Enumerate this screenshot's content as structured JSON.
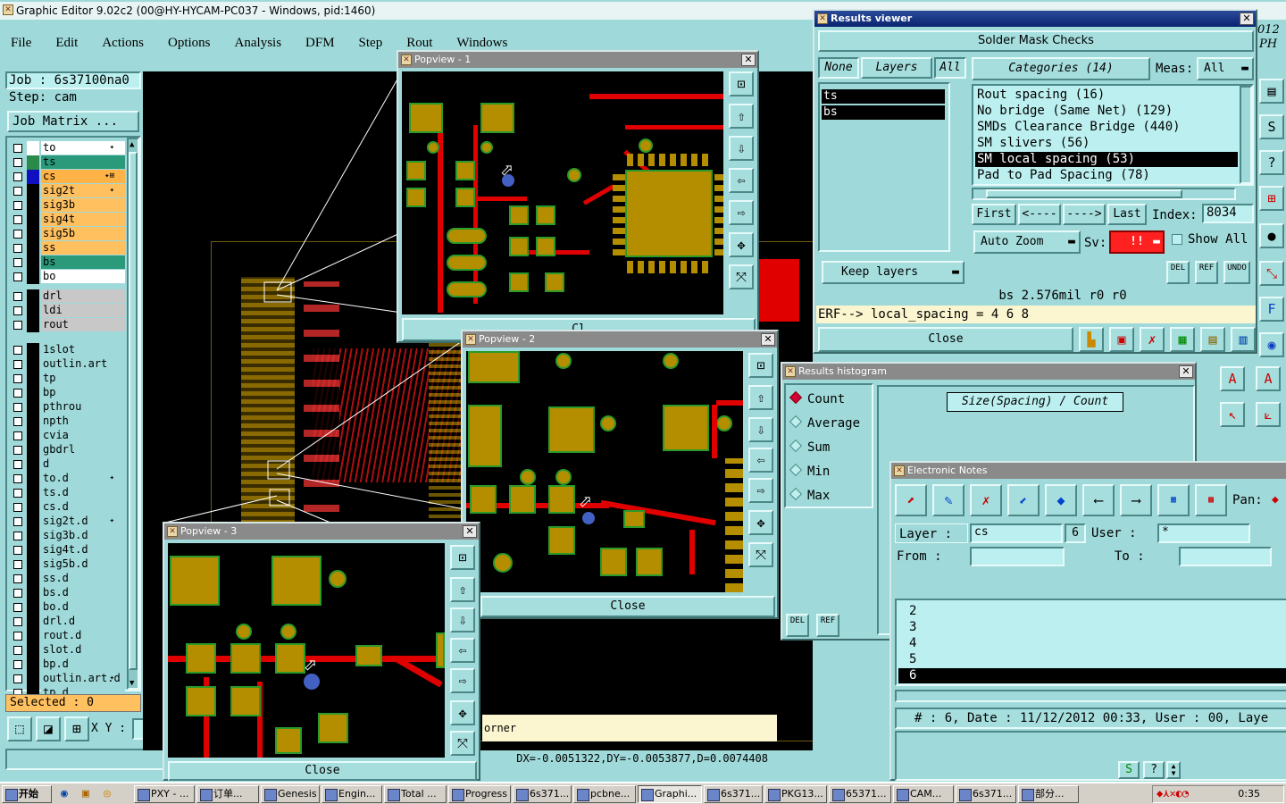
{
  "main": {
    "title": "Graphic Editor 9.02c2 (00@HY-HYCAM-PC037 - Windows, pid:1460)",
    "menu": [
      "File",
      "Edit",
      "Actions",
      "Options",
      "Analysis",
      "DFM",
      "Step",
      "Rout",
      "Windows"
    ],
    "job": "Job  : 6s37100na0",
    "step": "Step: cam",
    "job_matrix": "Job Matrix ...",
    "selected": "Selected : 0",
    "xy_label": "X Y :",
    "coords": "DX=-0.0051322,DY=-0.0053877,D=0.0074408",
    "corner_text": "orner",
    "right_edge_top": "012",
    "right_edge_bot": "PH"
  },
  "layers": [
    {
      "name": "to",
      "color": "#ffffff",
      "bg": "#ffffff",
      "mark": "✦"
    },
    {
      "name": "ts",
      "color": "#2a8a4a",
      "bg": "#2a9a7a",
      "mark": ""
    },
    {
      "name": "cs",
      "color": "#1010c0",
      "bg": "#ffb347",
      "mark": "✦⊞"
    },
    {
      "name": "sig2t",
      "color": "#000000",
      "bg": "#ffc060",
      "mark": "✦"
    },
    {
      "name": "sig3b",
      "color": "#000000",
      "bg": "#ffc060",
      "mark": ""
    },
    {
      "name": "sig4t",
      "color": "#000000",
      "bg": "#ffc060",
      "mark": ""
    },
    {
      "name": "sig5b",
      "color": "#000000",
      "bg": "#ffc060",
      "mark": ""
    },
    {
      "name": "ss",
      "color": "#000000",
      "bg": "#ffc060",
      "mark": ""
    },
    {
      "name": "bs",
      "color": "#000000",
      "bg": "#2a9a7a",
      "mark": ""
    },
    {
      "name": "bo",
      "color": "#000000",
      "bg": "#ffffff",
      "mark": ""
    },
    {
      "name": "drl",
      "color": "#000000",
      "bg": "#c8c8c8",
      "mark": ""
    },
    {
      "name": "ldi",
      "color": "#000000",
      "bg": "#c8c8c8",
      "mark": ""
    },
    {
      "name": "rout",
      "color": "#000000",
      "bg": "#c8c8c8",
      "mark": ""
    },
    {
      "name": "1slot",
      "color": "#000000",
      "bg": "#9fd9d9",
      "mark": ""
    },
    {
      "name": "outlin.art",
      "color": "#000000",
      "bg": "#9fd9d9",
      "mark": ""
    },
    {
      "name": "tp",
      "color": "#000000",
      "bg": "#9fd9d9",
      "mark": ""
    },
    {
      "name": "bp",
      "color": "#000000",
      "bg": "#9fd9d9",
      "mark": ""
    },
    {
      "name": "pthrou",
      "color": "#000000",
      "bg": "#9fd9d9",
      "mark": ""
    },
    {
      "name": "npth",
      "color": "#000000",
      "bg": "#9fd9d9",
      "mark": ""
    },
    {
      "name": "cvia",
      "color": "#000000",
      "bg": "#9fd9d9",
      "mark": ""
    },
    {
      "name": "gbdrl",
      "color": "#000000",
      "bg": "#9fd9d9",
      "mark": ""
    },
    {
      "name": "d",
      "color": "#000000",
      "bg": "#9fd9d9",
      "mark": ""
    },
    {
      "name": "to.d",
      "color": "#000000",
      "bg": "#9fd9d9",
      "mark": "✦"
    },
    {
      "name": "ts.d",
      "color": "#000000",
      "bg": "#9fd9d9",
      "mark": ""
    },
    {
      "name": "cs.d",
      "color": "#000000",
      "bg": "#9fd9d9",
      "mark": ""
    },
    {
      "name": "sig2t.d",
      "color": "#000000",
      "bg": "#9fd9d9",
      "mark": "✦"
    },
    {
      "name": "sig3b.d",
      "color": "#000000",
      "bg": "#9fd9d9",
      "mark": ""
    },
    {
      "name": "sig4t.d",
      "color": "#000000",
      "bg": "#9fd9d9",
      "mark": ""
    },
    {
      "name": "sig5b.d",
      "color": "#000000",
      "bg": "#9fd9d9",
      "mark": ""
    },
    {
      "name": "ss.d",
      "color": "#000000",
      "bg": "#9fd9d9",
      "mark": ""
    },
    {
      "name": "bs.d",
      "color": "#000000",
      "bg": "#9fd9d9",
      "mark": ""
    },
    {
      "name": "bo.d",
      "color": "#000000",
      "bg": "#9fd9d9",
      "mark": ""
    },
    {
      "name": "drl.d",
      "color": "#000000",
      "bg": "#9fd9d9",
      "mark": ""
    },
    {
      "name": "rout.d",
      "color": "#000000",
      "bg": "#9fd9d9",
      "mark": ""
    },
    {
      "name": "slot.d",
      "color": "#000000",
      "bg": "#9fd9d9",
      "mark": ""
    },
    {
      "name": "bp.d",
      "color": "#000000",
      "bg": "#9fd9d9",
      "mark": ""
    },
    {
      "name": "outlin.art.d",
      "color": "#000000",
      "bg": "#9fd9d9",
      "mark": "✦"
    },
    {
      "name": "tp.d",
      "color": "#000000",
      "bg": "#9fd9d9",
      "mark": ""
    }
  ],
  "popview1": {
    "title": "Popview - 1",
    "close": "Cl"
  },
  "popview2": {
    "title": "Popview - 2",
    "close": "Close"
  },
  "popview3": {
    "title": "Popview - 3",
    "close": "Close"
  },
  "results": {
    "title": "Results viewer",
    "header": "Solder Mask Checks",
    "none": "None",
    "layers": "Layers",
    "all": "All",
    "categories_label": "Categories (14)",
    "meas_label": "Meas:",
    "meas_value": "All",
    "layer_list": [
      "ts",
      "bs"
    ],
    "categories": [
      "Rout spacing (16)",
      "No bridge (Same Net) (129)",
      "SMDs Clearance Bridge (440)",
      "SM slivers (56)",
      "SM local spacing (53)",
      "Pad to Pad Spacing (78)"
    ],
    "selected_category": "SM local spacing (53)",
    "first": "First",
    "prev": "<----",
    "next": "---->",
    "last": "Last",
    "index_label": "Index:",
    "index_value": "8034",
    "auto_zoom": "Auto Zoom",
    "sv_label": "Sv:",
    "sv_value": "!!",
    "show_all": "Show All",
    "keep_layers": "Keep layers",
    "del": "DEL",
    "ref": "REF",
    "undo": "UNDO",
    "status1": "bs 2.576mil  r0  r0",
    "status2": "ERF--> local_spacing = 4 6 8",
    "close": "Close"
  },
  "histogram": {
    "title": "Results histogram",
    "options": [
      "Count",
      "Average",
      "Sum",
      "Min",
      "Max"
    ],
    "selected": "Count",
    "chart_title": "Size(Spacing) / Count",
    "del": "DEL",
    "ref": "REF"
  },
  "notes": {
    "title": "Electronic Notes",
    "pan_label": "Pan:",
    "layer_label": "Layer :",
    "layer_value": "cs",
    "layer_num": "6",
    "user_label": "User :",
    "user_value": "*",
    "from_label": "From  :",
    "to_label": "To    :",
    "list": [
      "2",
      "3",
      "4",
      "5",
      "6"
    ],
    "selected": "6",
    "info": "# : 6, Date : 11/12/2012 00:33, User : 00, Laye"
  },
  "taskbar": {
    "start": "开始",
    "items": [
      "PXY - ...",
      "订单...",
      "Genesis",
      "Engin...",
      "Total ...",
      "Progress",
      "6s371...",
      "pcbne...",
      "Graphi...",
      "6s371...",
      "PKG13...",
      "65371...",
      "CAM...",
      "6s371...",
      "部分..."
    ],
    "active": "Graphi...",
    "clock": "0:35"
  }
}
